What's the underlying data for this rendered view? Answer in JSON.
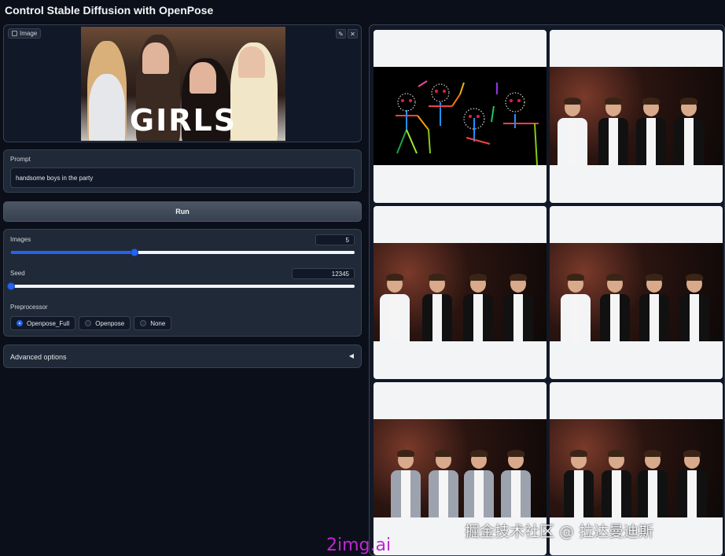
{
  "app": {
    "title": "Control Stable Diffusion with OpenPose"
  },
  "image_input": {
    "label": "Image",
    "overlay_text": "GIRLS",
    "edit_icon": "pencil-icon",
    "clear_icon": "close-icon"
  },
  "prompt": {
    "label": "Prompt",
    "value": "handsome boys in the party"
  },
  "run": {
    "label": "Run"
  },
  "images": {
    "label": "Images",
    "value": "5",
    "fraction": 0.36
  },
  "seed": {
    "label": "Seed",
    "value": "12345",
    "fraction": 0.0
  },
  "preprocessor": {
    "label": "Preprocessor",
    "options": [
      "Openpose_Full",
      "Openpose",
      "None"
    ],
    "selected": "Openpose_Full"
  },
  "advanced": {
    "label": "Advanced options",
    "arrow": "◀"
  },
  "gallery": {
    "tiles": [
      "pose-map",
      "photo",
      "photo",
      "photo",
      "photo",
      "photo"
    ]
  },
  "watermarks": {
    "cn": "掘金技术社区 @ 拉达曼迪斯",
    "en": "2img.ai"
  },
  "colors": {
    "accent": "#2563eb",
    "background": "#0b0f19",
    "panel": "#1f2937"
  }
}
